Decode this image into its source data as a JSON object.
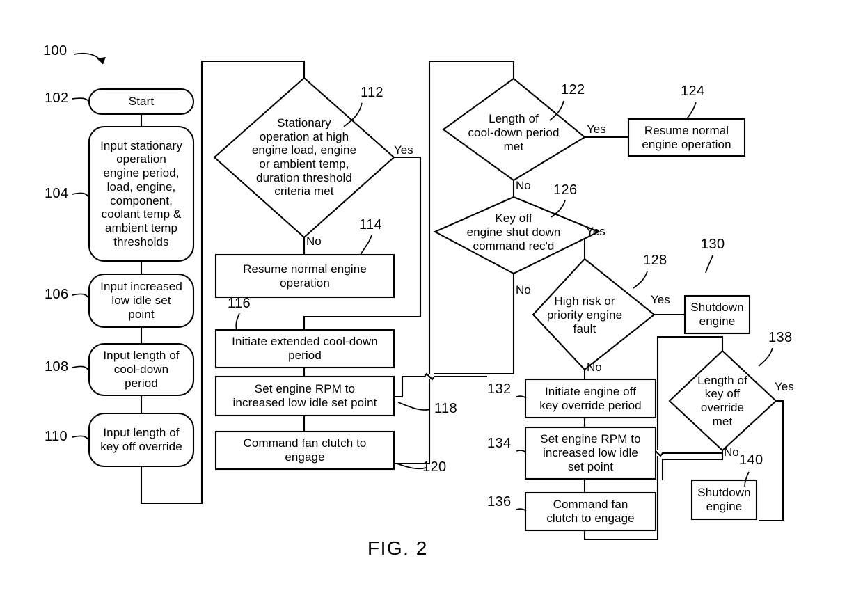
{
  "figure": {
    "caption": "FIG. 2",
    "diagram_ref": "100"
  },
  "nodes": {
    "start": {
      "ref": "102",
      "text": "Start",
      "shape": "terminator"
    },
    "input_thresholds": {
      "ref": "104",
      "text": "Input stationary\noperation\nengine period,\nload, engine,\ncomponent,\ncoolant temp &\nambient temp\nthresholds",
      "shape": "rounded"
    },
    "input_low_idle": {
      "ref": "106",
      "text": "Input increased\nlow idle set\npoint",
      "shape": "rounded"
    },
    "input_cooldown": {
      "ref": "108",
      "text": "Input length of\ncool-down\nperiod",
      "shape": "rounded"
    },
    "input_key_off": {
      "ref": "110",
      "text": "Input length of\nkey off override",
      "shape": "rounded"
    },
    "decision_stationary": {
      "ref": "112",
      "text": "Stationary\noperation at high\nengine load, engine\nor ambient temp,\nduration threshold\ncriteria met",
      "shape": "decision",
      "yes_label": "Yes",
      "no_label": "No"
    },
    "resume_normal_1": {
      "ref": "114",
      "text": "Resume normal engine\noperation",
      "shape": "process"
    },
    "initiate_cooldown": {
      "ref": "116",
      "text": "Initiate extended cool-down\nperiod",
      "shape": "process"
    },
    "set_rpm_1": {
      "ref": "118",
      "text": "Set engine RPM to\nincreased low idle set point",
      "shape": "process"
    },
    "fan_clutch_1": {
      "ref": "120",
      "text": "Command fan clutch to\nengage",
      "shape": "process"
    },
    "decision_cooldown_met": {
      "ref": "122",
      "text": "Length of\ncool-down period\nmet",
      "shape": "decision",
      "yes_label": "Yes",
      "no_label": "No"
    },
    "resume_normal_2": {
      "ref": "124",
      "text": "Resume normal\nengine operation",
      "shape": "process"
    },
    "decision_key_off": {
      "ref": "126",
      "text": "Key off\nengine shut down\ncommand rec'd",
      "shape": "decision",
      "yes_label": "Yes",
      "no_label": "No"
    },
    "decision_fault": {
      "ref": "128",
      "text": "High risk or\npriority engine\nfault",
      "shape": "decision",
      "yes_label": "Yes",
      "no_label": "No"
    },
    "shutdown_1": {
      "ref": "130",
      "text": "Shutdown\nengine",
      "shape": "process"
    },
    "initiate_key_override": {
      "ref": "132",
      "text": "Initiate engine off\nkey override period",
      "shape": "process"
    },
    "set_rpm_2": {
      "ref": "134",
      "text": "Set engine RPM to\nincreased low idle\nset point",
      "shape": "process"
    },
    "fan_clutch_2": {
      "ref": "136",
      "text": "Command fan\nclutch to engage",
      "shape": "process"
    },
    "decision_key_off_met": {
      "ref": "138",
      "text": "Length of\nkey off\noverride\nmet",
      "shape": "decision",
      "yes_label": "Yes",
      "no_label": "No"
    },
    "shutdown_2": {
      "ref": "140",
      "text": "Shutdown\nengine",
      "shape": "process"
    }
  },
  "branch_labels": {
    "d112_yes": "Yes",
    "d112_no": "No",
    "d122_yes": "Yes",
    "d122_no": "No",
    "d126_yes": "Yes",
    "d126_no": "No",
    "d128_yes": "Yes",
    "d128_no": "No",
    "d138_yes": "Yes",
    "d138_no": "No"
  },
  "refs": {
    "r100": "100",
    "r102": "102",
    "r104": "104",
    "r106": "106",
    "r108": "108",
    "r110": "110",
    "r112": "112",
    "r114": "114",
    "r116": "116",
    "r118": "118",
    "r120": "120",
    "r122": "122",
    "r124": "124",
    "r126": "126",
    "r128": "128",
    "r130": "130",
    "r132": "132",
    "r134": "134",
    "r136": "136",
    "r138": "138",
    "r140": "140"
  },
  "colors": {
    "stroke": "#000000",
    "fill": "#ffffff",
    "background": "#ffffff"
  }
}
